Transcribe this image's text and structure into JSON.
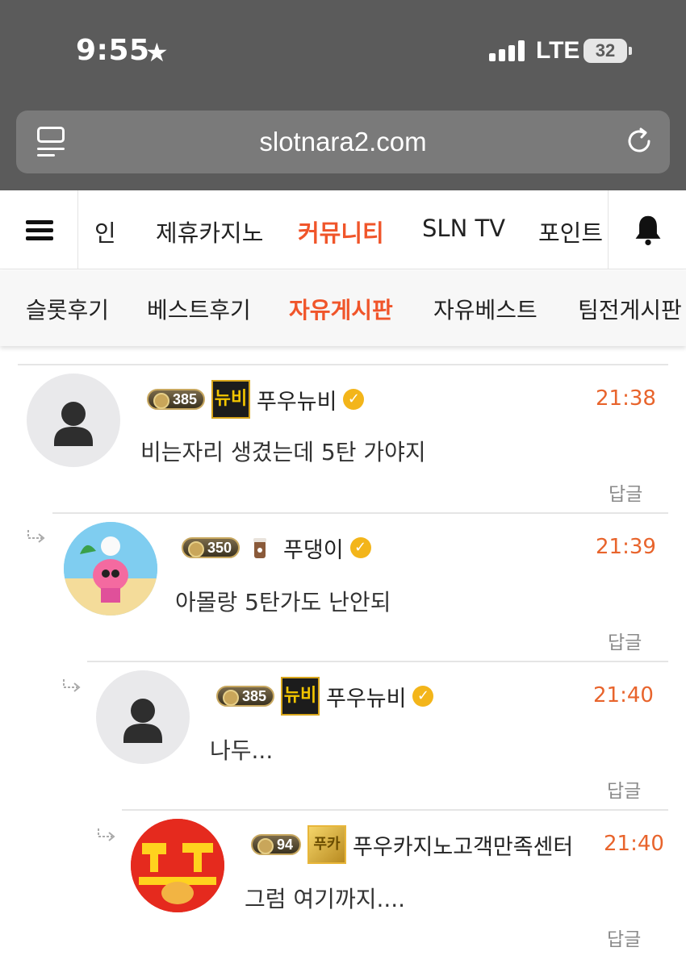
{
  "status_bar": {
    "time": "9:55",
    "star_icon": "star-icon",
    "network": "LTE",
    "battery": "32"
  },
  "browser": {
    "url": "slotnara2.com",
    "reader_icon": "reader-mode-icon",
    "reload_icon": "reload-icon"
  },
  "main_nav": {
    "menu_icon": "hamburger-menu-icon",
    "items": [
      {
        "label": "인",
        "active": false
      },
      {
        "label": "제휴카지노",
        "active": false
      },
      {
        "label": "커뮤니티",
        "active": true
      },
      {
        "label": "SLN TV",
        "active": false
      },
      {
        "label": "포인트",
        "active": false
      }
    ],
    "bell_icon": "bell-icon"
  },
  "sub_nav": {
    "items": [
      {
        "label": "슬롯후기",
        "active": false
      },
      {
        "label": "베스트후기",
        "active": false
      },
      {
        "label": "자유게시판",
        "active": true
      },
      {
        "label": "자유베스트",
        "active": false
      },
      {
        "label": "팀전게시판",
        "active": false
      }
    ]
  },
  "comments": [
    {
      "level": "385",
      "badge": "뉴비",
      "nick": "푸우뉴비",
      "time": "21:38",
      "text": "비는자리 생겼는데 5탄 가야지",
      "reply": "답글"
    },
    {
      "level": "350",
      "badge": "",
      "nick": "푸댕이",
      "time": "21:39",
      "text": "아몰랑 5탄가도 난안되",
      "reply": "답글"
    },
    {
      "level": "385",
      "badge": "뉴비",
      "nick": "푸우뉴비",
      "time": "21:40",
      "text": "나두...",
      "reply": "답글"
    },
    {
      "level": "94",
      "badge": "푸카",
      "nick": "푸우카지노고객만족센터",
      "time": "21:40",
      "text": "그럼 여기까지....",
      "reply": "답글"
    }
  ],
  "colors": {
    "accent": "#f0552a",
    "time": "#e8642c",
    "chrome": "#5b5b5b",
    "verified": "#f3b51a"
  }
}
